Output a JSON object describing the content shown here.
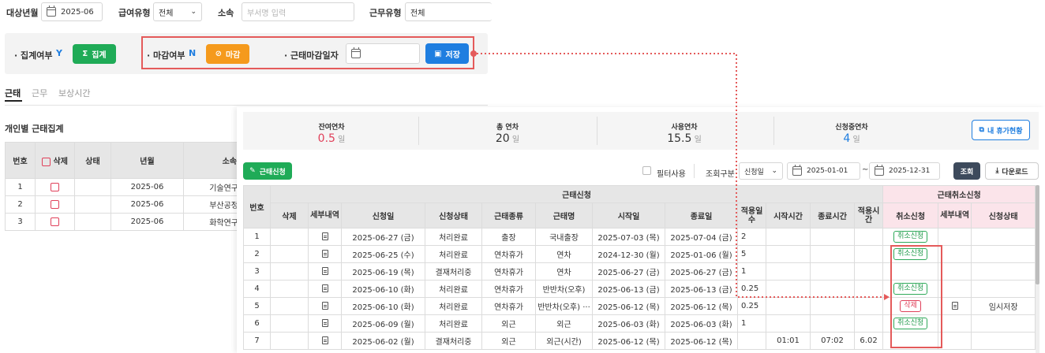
{
  "filters": {
    "month_label": "대상년월",
    "month_value": "2025-06",
    "pay_type_label": "급여유형",
    "pay_type_value": "전체",
    "dept_label": "소속",
    "dept_placeholder": "부서명 입력",
    "work_type_label": "근무유형",
    "work_type_value": "전체"
  },
  "status_bar": {
    "aggregate_label": "· 집계여부",
    "aggregate_value": "Y",
    "aggregate_button": "집계",
    "close_label": "· 마감여부",
    "close_value": "N",
    "close_button": "마감",
    "close_date_label": "· 근태마감일자",
    "save_button": "저장"
  },
  "tabs": [
    "근태",
    "근무",
    "보상시간"
  ],
  "left_panel": {
    "title": "개인별 근태집계",
    "headers": [
      "번호",
      "삭제",
      "상태",
      "년월",
      "소속"
    ],
    "rows": [
      {
        "no": "1",
        "month": "2025-06",
        "dept": "기술연구"
      },
      {
        "no": "2",
        "month": "2025-06",
        "dept": "부산공정"
      },
      {
        "no": "3",
        "month": "2025-06",
        "dept": "화학연구"
      }
    ]
  },
  "summary": {
    "items": [
      {
        "label": "잔여연차",
        "value": "0.5",
        "unit": "일",
        "color": "#e0405a"
      },
      {
        "label": "총 연차",
        "value": "20",
        "unit": "일",
        "color": "#333333"
      },
      {
        "label": "사용연차",
        "value": "15.5",
        "unit": "일",
        "color": "#333333"
      },
      {
        "label": "신청중연차",
        "value": "4",
        "unit": "일",
        "color": "#1f7ee0"
      }
    ],
    "my_leave_button": "내 휴가현황"
  },
  "toolbar": {
    "apply_button": "근태신청",
    "filter_use_label": "필터사용",
    "query_type_label": "조회구분",
    "query_type_value": "신청일",
    "date_from": "2025-01-01",
    "date_sep": "~",
    "date_to": "2025-12-31",
    "search_button": "조회",
    "download_button": "다운로드"
  },
  "table": {
    "group_main": "근태신청",
    "group_cancel": "근태취소신청",
    "headers": {
      "no": "번호",
      "del": "삭제",
      "detail": "세부내역",
      "apply_date": "신청일",
      "apply_status": "신청상태",
      "kind": "근태종류",
      "name": "근태명",
      "start": "시작일",
      "end": "종료일",
      "days": "적용일수",
      "start_time": "시작시간",
      "end_time": "종료시간",
      "hours": "적용시간",
      "cancel": "취소신청",
      "cancel_detail": "세부내역",
      "cancel_status": "신청상태"
    },
    "rows": [
      {
        "no": "1",
        "apply_date": "2025-06-27 (금)",
        "status": "처리완료",
        "kind": "출장",
        "name": "국내출장",
        "start": "2025-07-03 (목)",
        "end": "2025-07-04 (금)",
        "days": "2",
        "start_time": "",
        "end_time": "",
        "hours": "",
        "cancel": "취소신청",
        "cancel_type": "green",
        "cancel_detail": "",
        "cancel_status": ""
      },
      {
        "no": "2",
        "apply_date": "2025-06-25 (수)",
        "status": "처리완료",
        "kind": "연차휴가",
        "name": "연차",
        "start": "2024-12-30 (월)",
        "end": "2025-01-06 (월)",
        "days": "5",
        "start_time": "",
        "end_time": "",
        "hours": "",
        "cancel": "취소신청",
        "cancel_type": "green",
        "cancel_detail": "",
        "cancel_status": ""
      },
      {
        "no": "3",
        "apply_date": "2025-06-19 (목)",
        "status": "결재처리중",
        "kind": "연차휴가",
        "name": "연차",
        "start": "2025-06-27 (금)",
        "end": "2025-06-27 (금)",
        "days": "1",
        "start_time": "",
        "end_time": "",
        "hours": "",
        "cancel": "",
        "cancel_type": "",
        "cancel_detail": "",
        "cancel_status": ""
      },
      {
        "no": "4",
        "apply_date": "2025-06-10 (화)",
        "status": "처리완료",
        "kind": "연차휴가",
        "name": "반반차(오후)",
        "start": "2025-06-13 (금)",
        "end": "2025-06-13 (금)",
        "days": "0.25",
        "start_time": "",
        "end_time": "",
        "hours": "",
        "cancel": "취소신청",
        "cancel_type": "green",
        "cancel_detail": "",
        "cancel_status": ""
      },
      {
        "no": "5",
        "apply_date": "2025-06-10 (화)",
        "status": "처리완료",
        "kind": "연차휴가",
        "name": "반반차(오후) ···",
        "start": "2025-06-12 (목)",
        "end": "2025-06-12 (목)",
        "days": "0.25",
        "start_time": "",
        "end_time": "",
        "hours": "",
        "cancel": "삭제",
        "cancel_type": "red",
        "cancel_detail": "doc",
        "cancel_status": "임시저장"
      },
      {
        "no": "6",
        "apply_date": "2025-06-09 (월)",
        "status": "처리완료",
        "kind": "외근",
        "name": "외근",
        "start": "2025-06-03 (화)",
        "end": "2025-06-03 (화)",
        "days": "1",
        "start_time": "",
        "end_time": "",
        "hours": "",
        "cancel": "취소신청",
        "cancel_type": "green",
        "cancel_detail": "",
        "cancel_status": ""
      },
      {
        "no": "7",
        "apply_date": "2025-06-02 (월)",
        "status": "결재처리중",
        "kind": "외근",
        "name": "외근(시간)",
        "start": "2025-06-12 (목)",
        "end": "2025-06-12 (목)",
        "days": "",
        "start_time": "01:01",
        "end_time": "07:02",
        "hours": "6.02",
        "cancel": "",
        "cancel_type": "",
        "cancel_detail": "",
        "cancel_status": ""
      }
    ]
  },
  "colors": {
    "accent_green": "#1fab57",
    "accent_orange": "#f59a1c",
    "accent_blue": "#1f7ee0",
    "highlight_red": "#e45a5a"
  }
}
